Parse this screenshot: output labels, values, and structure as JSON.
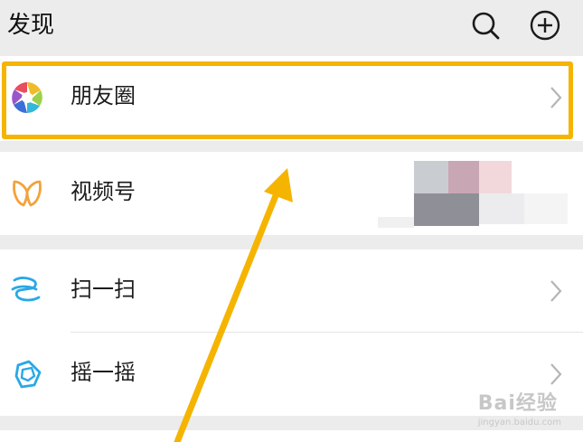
{
  "header": {
    "title": "发现",
    "search_icon": "search-icon",
    "add_icon": "plus-circle-icon"
  },
  "menu": {
    "moments": {
      "label": "朋友圈",
      "icon": "moments-aperture-icon"
    },
    "channels": {
      "label": "视频号",
      "icon": "channels-butterfly-icon"
    },
    "scan": {
      "label": "扫一扫",
      "icon": "scan-icon"
    },
    "shake": {
      "label": "摇一摇",
      "icon": "shake-icon"
    }
  },
  "annotation": {
    "highlight_color": "#f5b400",
    "arrow_color": "#f5b400"
  },
  "watermark": {
    "brand": "Bai经验",
    "url": "jingyan.baidu.com"
  },
  "colors": {
    "background": "#ececec",
    "card": "#ffffff",
    "channels_icon": "#f3a23a",
    "scan_icon": "#2aa8e6"
  }
}
